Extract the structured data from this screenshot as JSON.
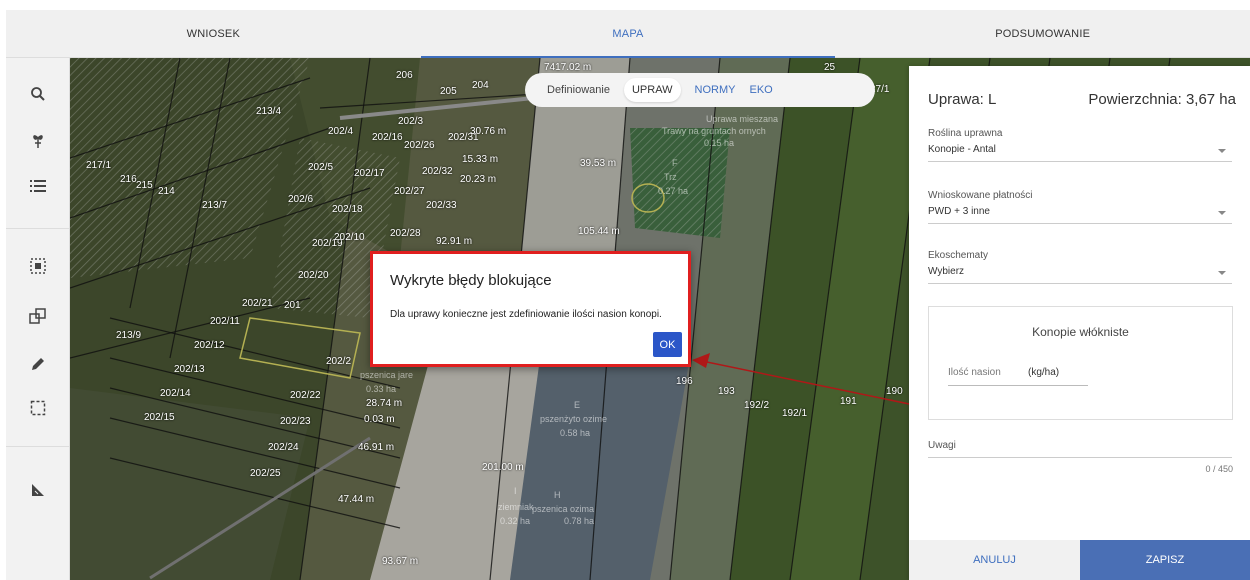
{
  "tabs": [
    {
      "label": "WNIOSEK"
    },
    {
      "label": "MAPA"
    },
    {
      "label": "PODSUMOWANIE"
    }
  ],
  "toolbar": {
    "icons": [
      "search-icon",
      "plant-icon",
      "list-icon",
      "select-area-icon",
      "copy-shapes-icon",
      "pencil-icon",
      "rectangle-select-icon",
      "measure-icon"
    ]
  },
  "map": {
    "mode_label": "Definiowanie",
    "modes": [
      "UPRAW",
      "NORMY",
      "EKO"
    ],
    "selected_mode": "UPRAW",
    "parcel_labels": [
      "206",
      "205",
      "204",
      "213/4",
      "202/4",
      "202/3",
      "202/16",
      "202/26",
      "202/31",
      "217/1",
      "216",
      "215",
      "214",
      "202/5",
      "202/17",
      "202/32",
      "213/7",
      "202/6",
      "202/18",
      "202/27",
      "202/33",
      "202/19",
      "202/10",
      "202/28",
      "202/20",
      "202/21",
      "201",
      "202/11",
      "213/9",
      "202/12",
      "202/13",
      "202/2",
      "202/14",
      "202/22",
      "202/15",
      "202/23",
      "202/24",
      "202/25",
      "196",
      "193",
      "192/2",
      "192/1",
      "191",
      "190",
      "27/1",
      "25"
    ],
    "distance_labels": [
      "7417.02 m",
      "30.76 m",
      "15.33 m",
      "39.53 m",
      "20.23 m",
      "105.44 m",
      "92.91 m",
      "28.74 m",
      "0.03 m",
      "46.91 m",
      "201.00 m",
      "47.44 m",
      "93.67 m"
    ],
    "crop_labels": [
      {
        "name": "Uprawa mieszana",
        "extra": "Trawy na gruntach ornych",
        "area": "0.15 ha"
      },
      {
        "name": "F",
        "extra": "Trz",
        "area": "0.27 ha"
      },
      {
        "name": "pszenica jare",
        "extra": "",
        "area": "0.33 ha"
      },
      {
        "name": "E",
        "extra": "pszenżyto ozime",
        "area": "0.58 ha"
      },
      {
        "name": "I",
        "extra": "ziemniak",
        "area": "0.32 ha"
      },
      {
        "name": "H",
        "extra": "pszenica ozima",
        "area": "0.78 ha"
      }
    ]
  },
  "modal": {
    "title": "Wykryte błędy blokujące",
    "message": "Dla uprawy konieczne jest zdefiniowanie ilości nasion konopi.",
    "ok_label": "OK"
  },
  "panel": {
    "title": "Uprawa: L",
    "area": "Powierzchnia: 3,67 ha",
    "roslina_label": "Roślina uprawna",
    "roslina_value": "Konopie - Antal",
    "platnosci_label": "Wnioskowane płatności",
    "platnosci_value": "PWD + 3 inne",
    "eko_label": "Ekoschematy",
    "eko_value": "Wybierz",
    "box_title": "Konopie włókniste",
    "nasion_label": "Ilość nasion",
    "nasion_unit": "(kg/ha)",
    "uwagi_label": "Uwagi",
    "counter": "0 / 450",
    "cancel_label": "ANULUJ",
    "save_label": "ZAPISZ"
  },
  "colors": {
    "accent": "#3f6fbf",
    "ok_button": "#2b56c8",
    "modal_border": "#e01f1f",
    "save_button": "#4a6fb5",
    "arrow": "#e01f1f"
  }
}
